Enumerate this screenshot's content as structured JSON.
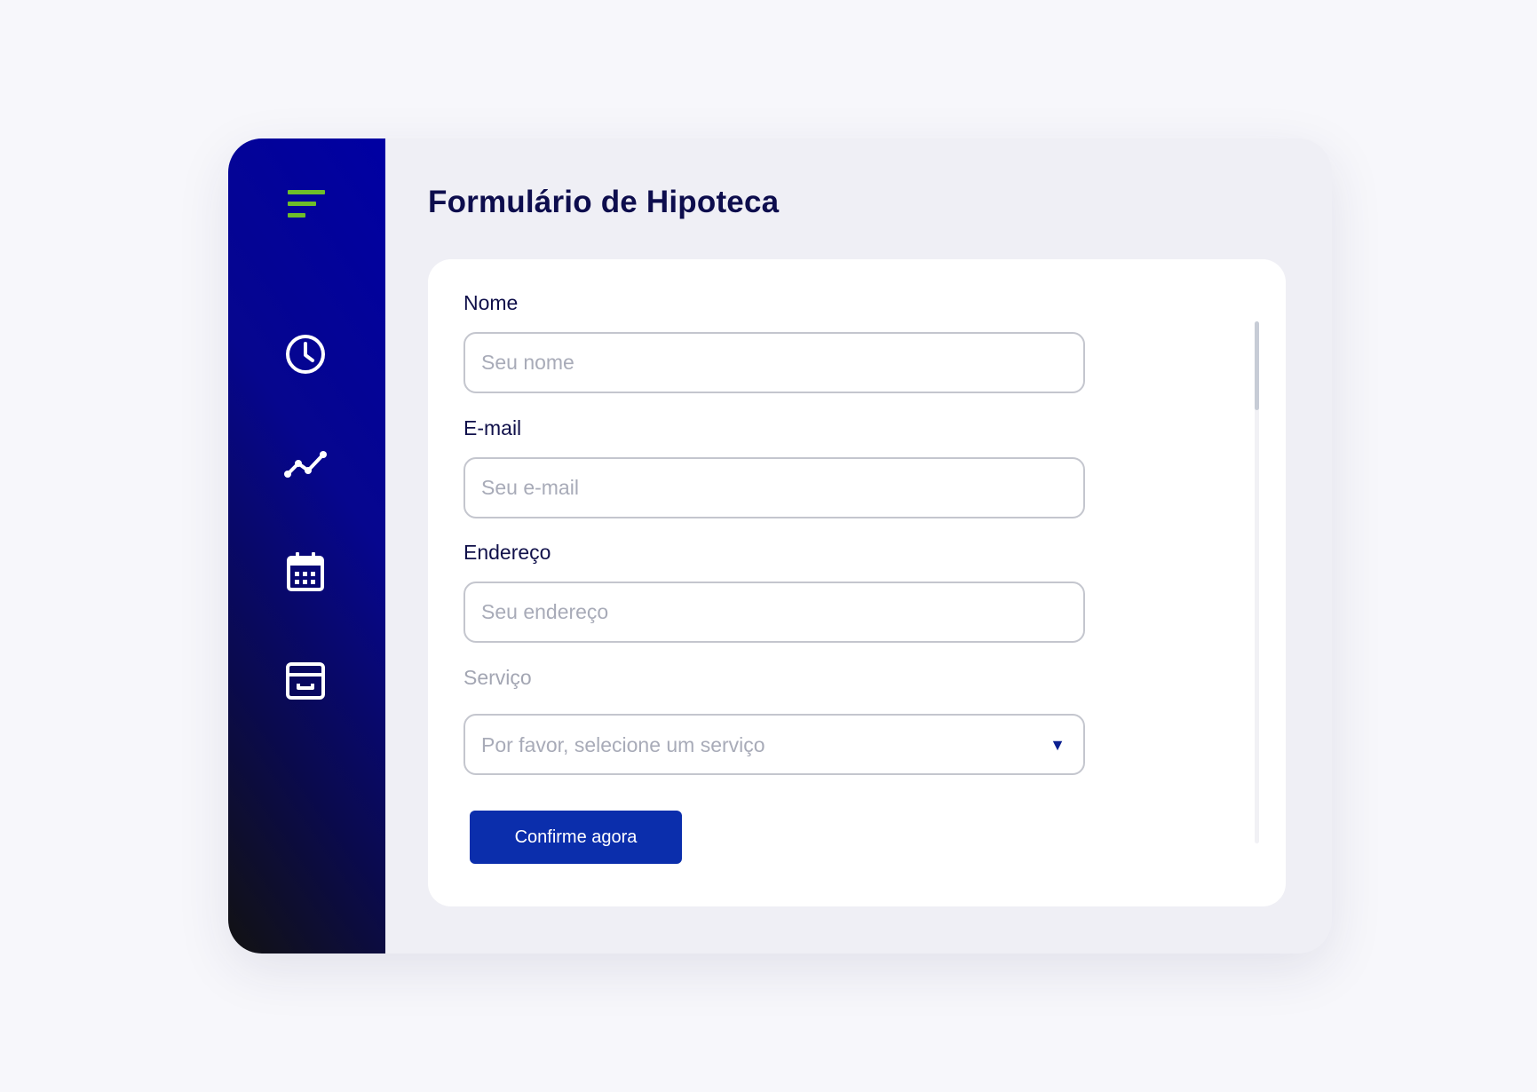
{
  "sidebar": {
    "menu_icon": "menu-icon",
    "accent_color": "#6ebd2a",
    "items": [
      {
        "icon": "clock-icon",
        "name": "history"
      },
      {
        "icon": "trend-line-icon",
        "name": "analytics"
      },
      {
        "icon": "calendar-icon",
        "name": "calendar"
      },
      {
        "icon": "archive-box-icon",
        "name": "archive"
      }
    ]
  },
  "page": {
    "title": "Formulário de Hipoteca"
  },
  "form": {
    "name": {
      "label": "Nome",
      "placeholder": "Seu nome",
      "value": ""
    },
    "email": {
      "label": "E-mail",
      "placeholder": "Seu e-mail",
      "value": ""
    },
    "address": {
      "label": "Endereço",
      "placeholder": "Seu endereço",
      "value": ""
    },
    "service": {
      "label": "Serviço",
      "selected": "Por favor, selecione um serviço",
      "arrow": "▼"
    },
    "submit_label": "Confirme agora"
  },
  "colors": {
    "sidebar_gradient_start": "#0000a3",
    "sidebar_gradient_end": "#121212",
    "title": "#0d0d4d",
    "button": "#0b2eac",
    "background": "#f7f7fb"
  }
}
